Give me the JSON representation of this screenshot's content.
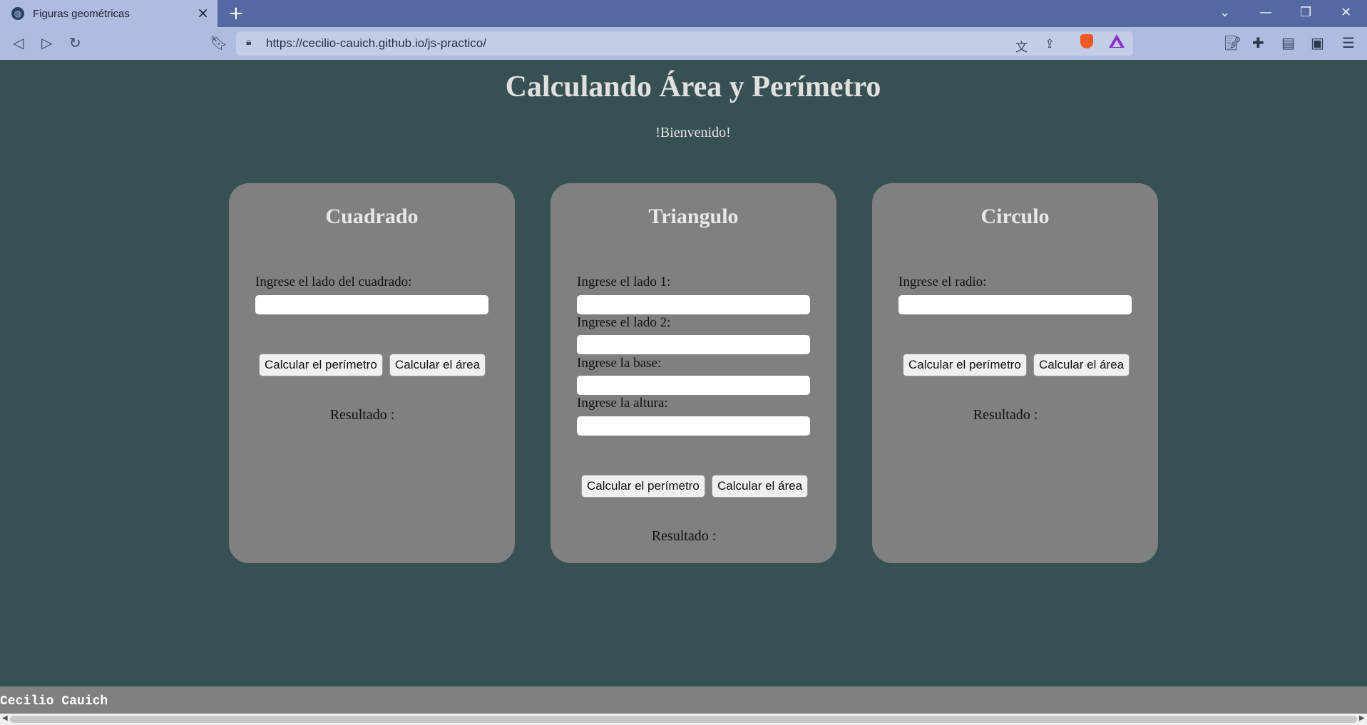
{
  "browser": {
    "tab_title": "Figuras geométricas",
    "new_tab": "+",
    "url": "https://cecilio-cauich.github.io/js-practico/",
    "window_controls": [
      "⌵",
      "—",
      "❐",
      "✕"
    ]
  },
  "page": {
    "title": "Calculando Área y Perímetro",
    "welcome": "!Bienvenido!"
  },
  "cards": {
    "square": {
      "title": "Cuadrado",
      "label_side": "Ingrese el lado del cuadrado:",
      "perimeter_button": "Calcular el perímetro",
      "area_button": "Calcular el área",
      "result": "Resultado :"
    },
    "triangle": {
      "title": "Triangulo",
      "label_side1": "Ingrese el lado 1:",
      "label_side2": "Ingrese el lado 2:",
      "label_base": "Ingrese la base:",
      "label_height": "Ingrese la altura:",
      "perimeter_button": "Calcular el perímetro",
      "area_button": "Calcular el área",
      "result": "Resultado :"
    },
    "circle": {
      "title": "Circulo",
      "label_radius": "Ingrese el radio:",
      "perimeter_button": "Calcular el perímetro",
      "area_button": "Calcular el área",
      "result": "Resultado :"
    }
  },
  "footer": {
    "author": "Cecilio Cauich"
  },
  "colors": {
    "page_background": "#375051",
    "card_background": "#808080",
    "tab_bar": "#5469a2",
    "toolbar": "#aebcdf"
  }
}
